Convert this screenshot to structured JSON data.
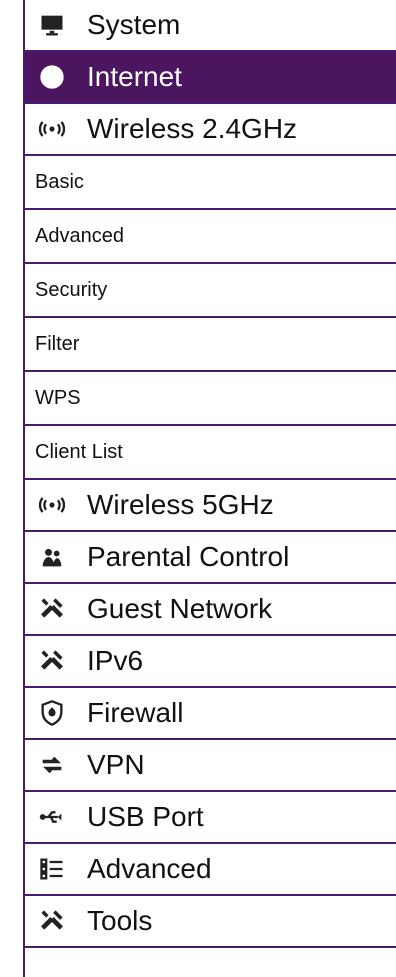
{
  "menu": {
    "items": [
      {
        "type": "main",
        "label": "System",
        "icon": "monitor-icon"
      },
      {
        "type": "main",
        "label": "Internet",
        "icon": "globe-icon",
        "active": true
      },
      {
        "type": "main",
        "label": "Wireless 2.4GHz",
        "icon": "wireless-icon"
      },
      {
        "type": "sub",
        "label": "Basic"
      },
      {
        "type": "sub",
        "label": "Advanced"
      },
      {
        "type": "sub",
        "label": "Security"
      },
      {
        "type": "sub",
        "label": "Filter"
      },
      {
        "type": "sub",
        "label": "WPS"
      },
      {
        "type": "sub",
        "label": "Client List"
      },
      {
        "type": "main",
        "label": "Wireless 5GHz",
        "icon": "wireless-icon"
      },
      {
        "type": "main",
        "label": "Parental Control",
        "icon": "users-icon"
      },
      {
        "type": "main",
        "label": "Guest Network",
        "icon": "tools-icon"
      },
      {
        "type": "main",
        "label": "IPv6",
        "icon": "tools-icon"
      },
      {
        "type": "main",
        "label": "Firewall",
        "icon": "firewall-icon"
      },
      {
        "type": "main",
        "label": "VPN",
        "icon": "vpn-arrows-icon"
      },
      {
        "type": "main",
        "label": "USB Port",
        "icon": "usb-icon"
      },
      {
        "type": "main",
        "label": "Advanced",
        "icon": "list-icon"
      },
      {
        "type": "main",
        "label": "Tools",
        "icon": "tools-icon"
      }
    ]
  },
  "colors": {
    "accent": "#4b1a70",
    "active_bg": "#4b1560",
    "active_text": "#ffffff"
  }
}
